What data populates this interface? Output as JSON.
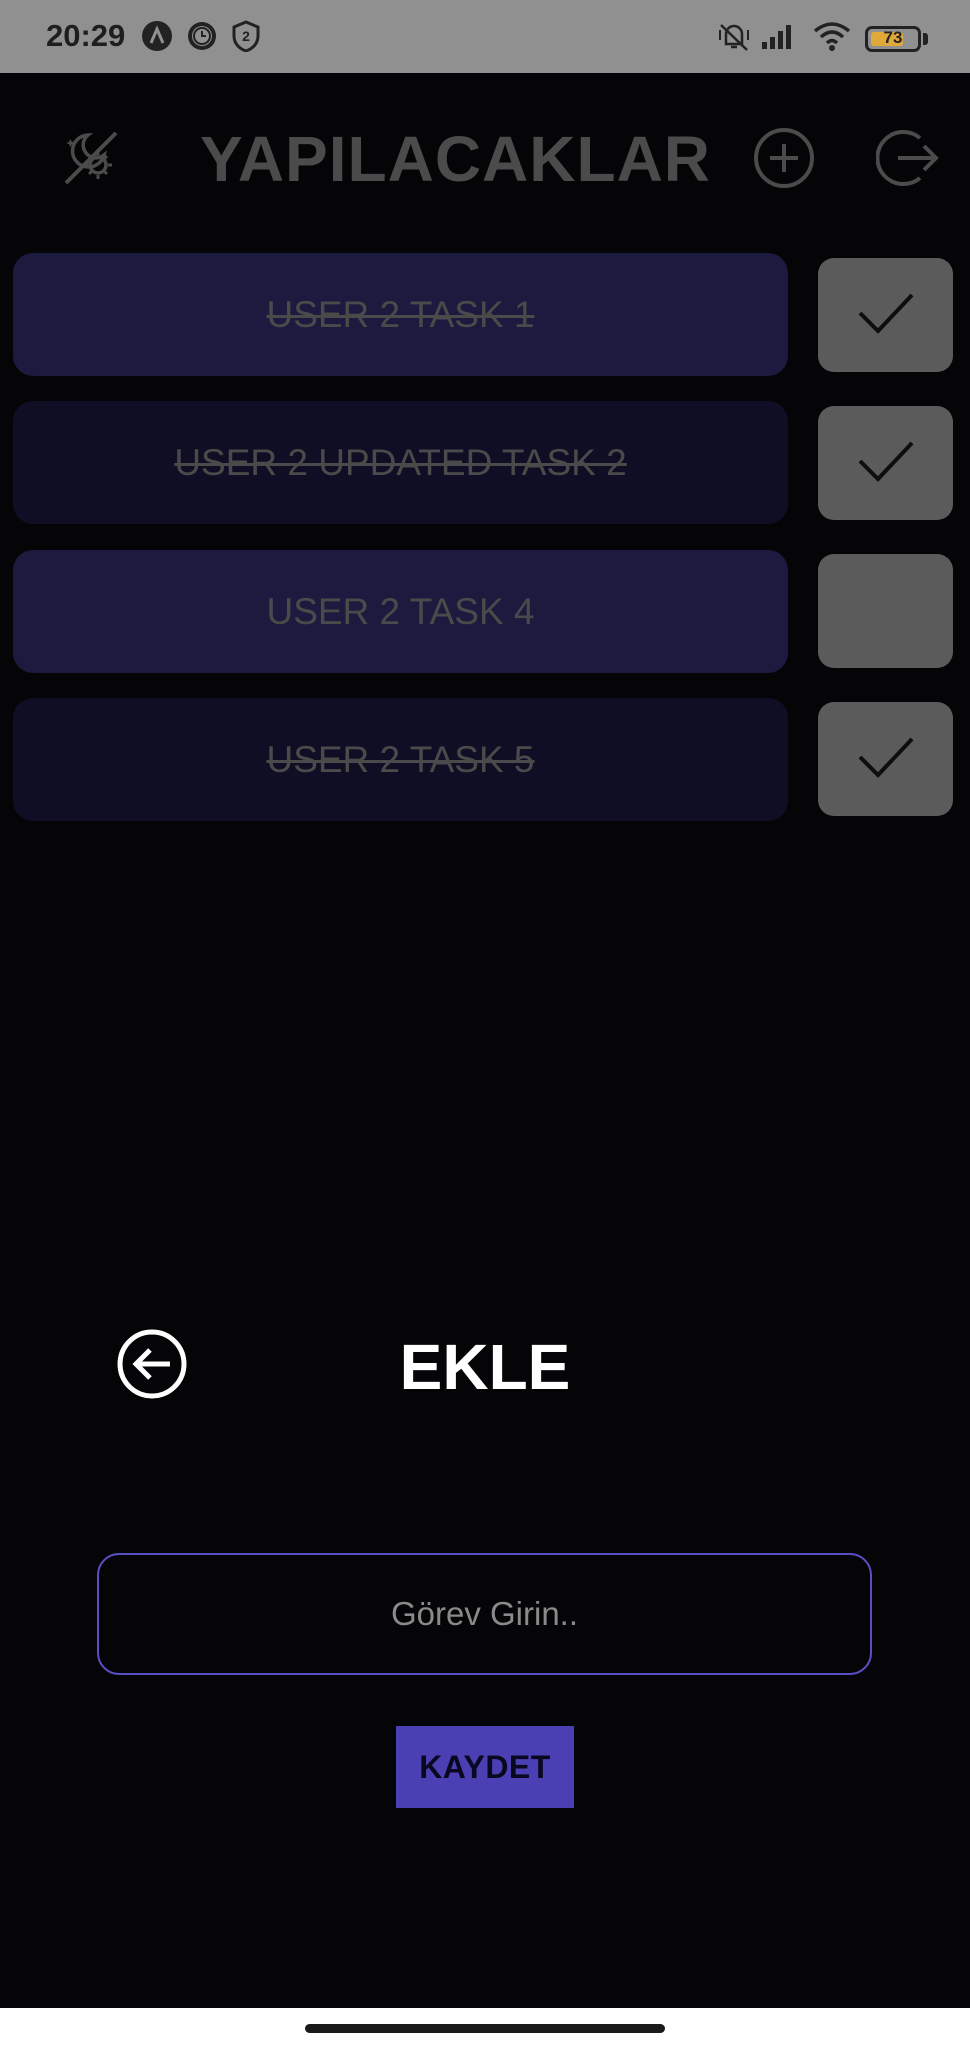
{
  "status_bar": {
    "time": "20:29",
    "battery_level": "73",
    "battery_fraction": 0.73,
    "left_icons": [
      "navigation-a-icon",
      "clock-icon",
      "shield-2-icon"
    ],
    "right_icons": [
      "mute-vibrate-icon",
      "signal-icon",
      "wifi-icon",
      "battery-icon"
    ]
  },
  "header": {
    "title": "YAPILACAKLAR",
    "theme_toggle_icon": "theme-toggle-icon",
    "add_icon": "add-circle-icon",
    "logout_icon": "logout-icon"
  },
  "tasks": [
    {
      "text": "USER 2 TASK 1",
      "done": true,
      "style": "light"
    },
    {
      "text": "USER 2 UPDATED TASK 2",
      "done": true,
      "style": "dark"
    },
    {
      "text": "USER 2 TASK 4",
      "done": false,
      "style": "light"
    },
    {
      "text": "USER 2 TASK 5",
      "done": true,
      "style": "dark"
    }
  ],
  "modal": {
    "title": "EKLE",
    "back_icon": "back-arrow-icon",
    "input_placeholder": "Görev Girin..",
    "input_value": "",
    "save_label": "KAYDET"
  },
  "colors": {
    "accent": "#4a40b3",
    "input_border": "#5b4fc8",
    "card_light": "#1c1a3e",
    "card_dark": "#0f0e24",
    "checkbox": "#5b5b5b",
    "status_bar": "#909090"
  }
}
